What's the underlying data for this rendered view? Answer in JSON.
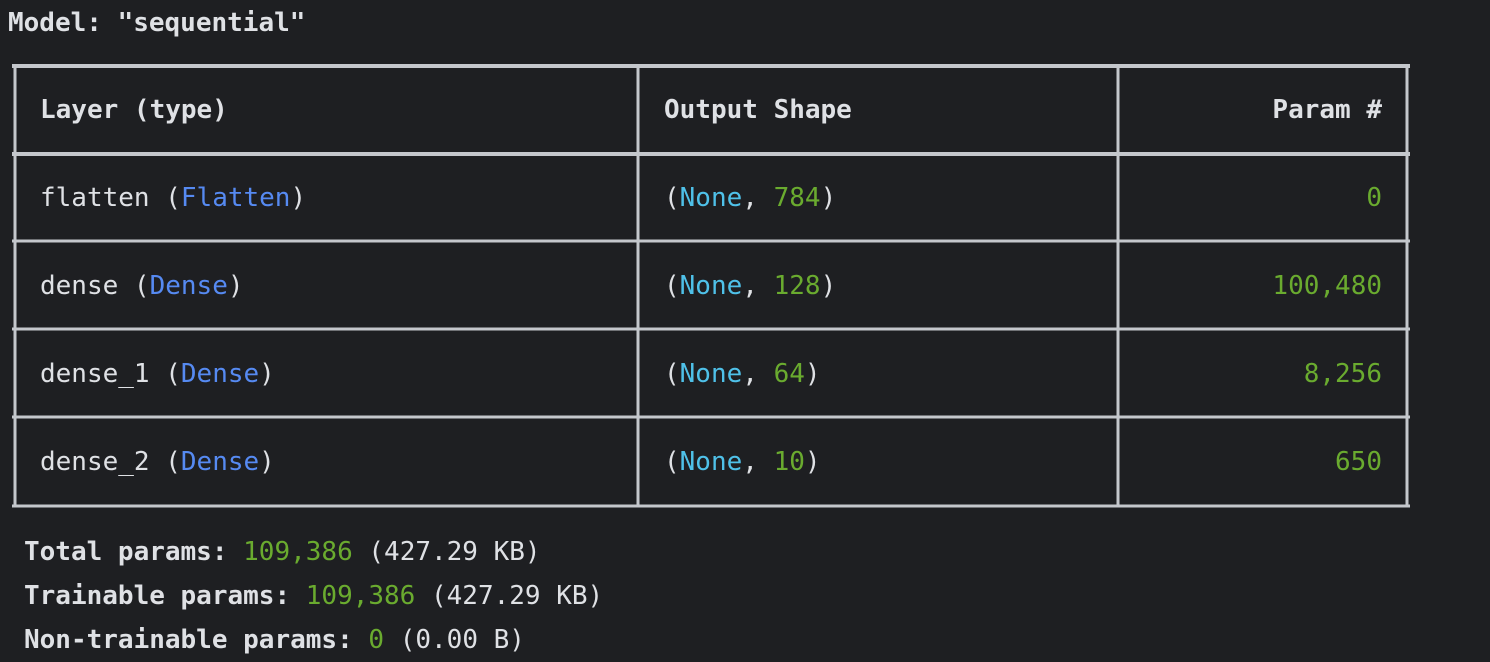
{
  "model_title": "Model: \"sequential\"",
  "table": {
    "headers": {
      "layer": "Layer (type)",
      "output": "Output Shape",
      "params": "Param #"
    },
    "rows": [
      {
        "name": "flatten",
        "type": "Flatten",
        "shape_none": "None",
        "shape_dim": "784",
        "params": "0"
      },
      {
        "name": "dense",
        "type": "Dense",
        "shape_none": "None",
        "shape_dim": "128",
        "params": "100,480"
      },
      {
        "name": "dense_1",
        "type": "Dense",
        "shape_none": "None",
        "shape_dim": "64",
        "params": "8,256"
      },
      {
        "name": "dense_2",
        "type": "Dense",
        "shape_none": "None",
        "shape_dim": "10",
        "params": "650"
      }
    ]
  },
  "totals": {
    "total_label": "Total params:",
    "total_count": "109,386",
    "total_size": "(427.29 KB)",
    "trainable_label": "Trainable params:",
    "trainable_count": "109,386",
    "trainable_size": "(427.29 KB)",
    "non_trainable_label": "Non-trainable params:",
    "non_trainable_count": "0",
    "non_trainable_size": "(0.00 B)"
  },
  "colors": {
    "background": "#1e1f22",
    "text": "#dfe1e5",
    "border": "#c4c7cc",
    "type_blue": "#568af2",
    "none_cyan": "#4fc1e9",
    "number_green": "#6aab2f"
  }
}
